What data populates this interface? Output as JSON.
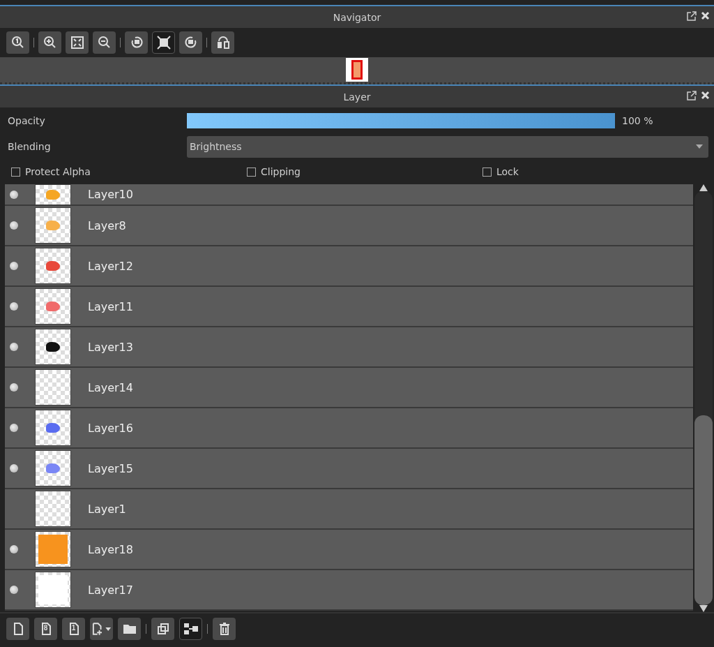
{
  "navigator": {
    "title": "Navigator",
    "tools": [
      {
        "selected": false
      },
      {
        "selected": false
      },
      {
        "selected": false
      },
      {
        "selected": false
      },
      {
        "selected": false
      },
      {
        "selected": true
      },
      {
        "selected": false
      },
      {
        "selected": false
      }
    ]
  },
  "layer_panel": {
    "title": "Layer",
    "opacity": {
      "label": "Opacity",
      "level": 1,
      "reading": "100 %"
    },
    "blending": {
      "label": "Blending",
      "value": "Brightness"
    },
    "options": [
      {
        "label": "Protect Alpha",
        "checked": false
      },
      {
        "label": "Clipping",
        "checked": false
      },
      {
        "label": "Lock",
        "checked": false
      }
    ],
    "layers": [
      {
        "name": "Layer10",
        "visible": true,
        "kind": "blob",
        "color": "#f5a623"
      },
      {
        "name": "Layer8",
        "visible": true,
        "kind": "blob",
        "color": "#f7b04a"
      },
      {
        "name": "Layer12",
        "visible": true,
        "kind": "blob",
        "color": "#e8483a"
      },
      {
        "name": "Layer11",
        "visible": true,
        "kind": "blob",
        "color": "#f06a6a"
      },
      {
        "name": "Layer13",
        "visible": true,
        "kind": "blob",
        "color": "#111111"
      },
      {
        "name": "Layer14",
        "visible": true,
        "kind": "empty"
      },
      {
        "name": "Layer16",
        "visible": true,
        "kind": "blob",
        "color": "#5a6cf0"
      },
      {
        "name": "Layer15",
        "visible": true,
        "kind": "blob",
        "color": "#7a86f5"
      },
      {
        "name": "Layer1",
        "visible": false,
        "kind": "empty"
      },
      {
        "name": "Layer18",
        "visible": true,
        "kind": "fill",
        "color": "#f7931e"
      },
      {
        "name": "Layer17",
        "visible": true,
        "kind": "fill",
        "color": "#ffffff"
      }
    ],
    "actions": [
      {
        "selected": false
      },
      {
        "selected": false,
        "glyph": "8"
      },
      {
        "selected": false,
        "glyph": "1"
      },
      {
        "selected": false
      },
      {
        "selected": false
      },
      {
        "selected": false
      },
      {
        "selected": true
      },
      {
        "selected": false
      }
    ]
  }
}
